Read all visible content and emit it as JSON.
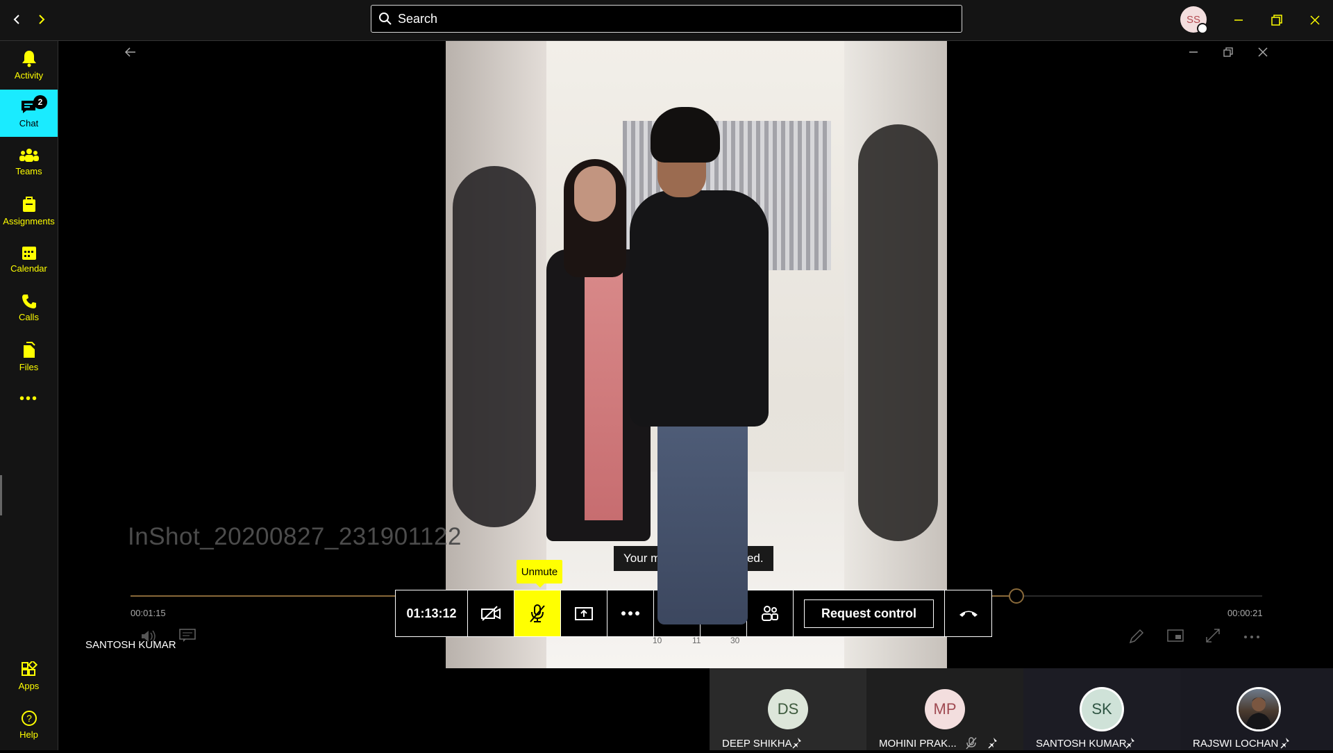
{
  "search": {
    "placeholder": "Search"
  },
  "user": {
    "initials": "SS"
  },
  "rail": {
    "items": [
      {
        "label": "Activity",
        "icon": "bell-icon"
      },
      {
        "label": "Chat",
        "icon": "chat-icon",
        "badge": "2",
        "active": true
      },
      {
        "label": "Teams",
        "icon": "teams-icon"
      },
      {
        "label": "Assignments",
        "icon": "assignments-icon"
      },
      {
        "label": "Calendar",
        "icon": "calendar-icon"
      },
      {
        "label": "Calls",
        "icon": "phone-icon"
      },
      {
        "label": "Files",
        "icon": "files-icon"
      }
    ],
    "more": "•••",
    "apps": "Apps",
    "help": "Help"
  },
  "media": {
    "filename": "InShot_20200827_231901122",
    "elapsed": "00:01:15",
    "remaining": "00:00:21",
    "progress": 0.78,
    "presenter": "SANTOSH KUMAR",
    "scale": [
      "10",
      "11",
      "30"
    ]
  },
  "toast": "Your microphone is muted.",
  "tooltip": "Unmute",
  "call": {
    "duration": "01:13:12",
    "request_control": "Request control"
  },
  "participants": [
    {
      "initials": "DS",
      "name": "DEEP SHIKHA",
      "bg": "#dde6da",
      "fg": "#3d5a3d"
    },
    {
      "initials": "MP",
      "name": "MOHINI PRAK...",
      "bg": "#f3dede",
      "fg": "#a04a52",
      "muted": true
    },
    {
      "initials": "SK",
      "name": "SANTOSH KUMAR",
      "bg": "#cfe2d8",
      "fg": "#2f5543"
    },
    {
      "initials": "",
      "name": "RAJSWI LOCHAN",
      "bg": "#4a3a2e",
      "fg": "#fff"
    }
  ],
  "colors": {
    "accent": "#ffff01",
    "rail_active": "#1aebff"
  }
}
